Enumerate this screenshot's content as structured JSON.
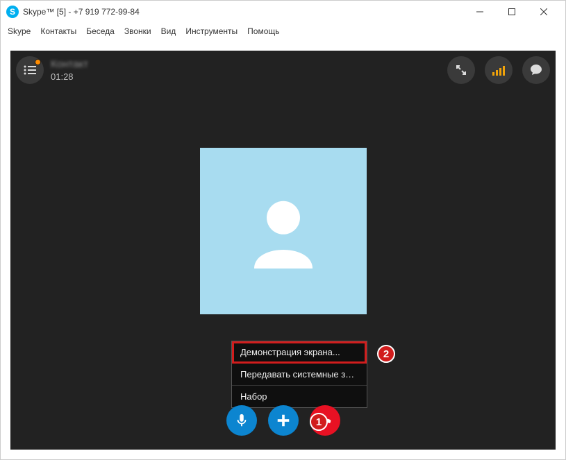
{
  "window": {
    "title": "Skype™ [5] - +7 919 772-99-84"
  },
  "menu": {
    "items": [
      "Skype",
      "Контакты",
      "Беседа",
      "Звонки",
      "Вид",
      "Инструменты",
      "Помощь"
    ]
  },
  "call": {
    "contact_name": "Контакт",
    "timer": "01:28"
  },
  "popup": {
    "items": [
      "Демонстрация экрана...",
      "Передавать системные звуки...",
      "Набор"
    ]
  },
  "annotations": {
    "badge1": "1",
    "badge2": "2"
  }
}
